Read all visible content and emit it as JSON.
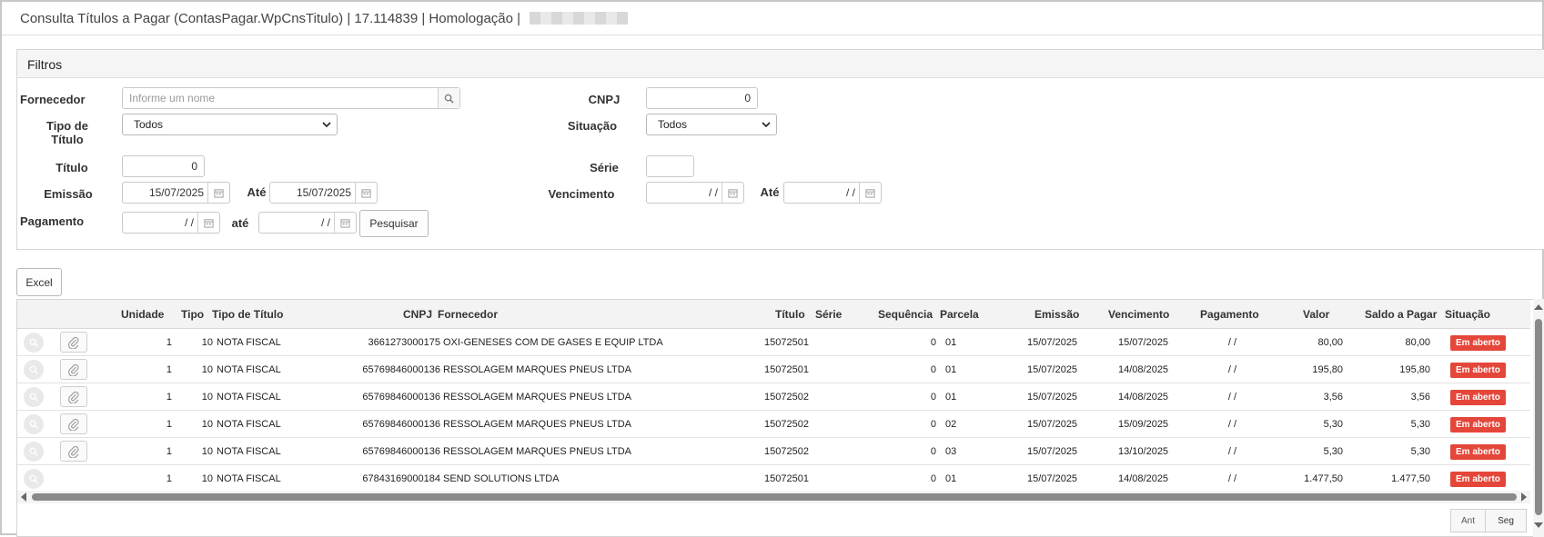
{
  "window": {
    "title": "Consulta Títulos a Pagar (ContasPagar.WpCnsTitulo) | 17.114839 | Homologação |"
  },
  "filters": {
    "header": "Filtros",
    "fornecedor_label": "Fornecedor",
    "fornecedor_placeholder": "Informe um nome",
    "cnpj_label": "CNPJ",
    "cnpj_value": "0",
    "tipo_titulo_label": "Tipo de Título",
    "tipo_titulo_value": "Todos",
    "situacao_label": "Situação",
    "situacao_value": "Todos",
    "titulo_label": "Título",
    "titulo_value": "0",
    "serie_label": "Série",
    "serie_value": "",
    "emissao_label": "Emissão",
    "emissao_de": "15/07/2025",
    "ate_label": "Até",
    "emissao_ate": "15/07/2025",
    "vencimento_label": "Vencimento",
    "vencimento_de": "/ /",
    "vencimento_ate": "/ /",
    "pagamento_label": "Pagamento",
    "pagamento_de": "/ /",
    "ate_lower_label": "até",
    "pagamento_ate": "/ /",
    "pesquisar_label": "Pesquisar"
  },
  "toolbar": {
    "excel_label": "Excel"
  },
  "table": {
    "headers": [
      "Unidade",
      "Tipo",
      "Tipo de Título",
      "CNPJ",
      "Fornecedor",
      "Título",
      "Série",
      "Sequência",
      "Parcela",
      "Emissão",
      "Vencimento",
      "Pagamento",
      "Valor",
      "Saldo a Pagar",
      "Situação"
    ],
    "rows": [
      {
        "unidade": "1",
        "tipo": "10",
        "tipo_titulo": "NOTA FISCAL",
        "cnpj": "3661273000175",
        "fornecedor": "OXI-GENESES COM DE GASES E EQUIP LTDA",
        "titulo": "15072501",
        "serie": "",
        "sequencia": "0",
        "parcela": "01",
        "emissao": "15/07/2025",
        "vencimento": "15/07/2025",
        "pagamento": "/ /",
        "valor": "80,00",
        "saldo": "80,00",
        "situacao": "Em aberto",
        "has_attach": true
      },
      {
        "unidade": "1",
        "tipo": "10",
        "tipo_titulo": "NOTA FISCAL",
        "cnpj": "65769846000136",
        "fornecedor": "RESSOLAGEM MARQUES PNEUS LTDA",
        "titulo": "15072501",
        "serie": "",
        "sequencia": "0",
        "parcela": "01",
        "emissao": "15/07/2025",
        "vencimento": "14/08/2025",
        "pagamento": "/ /",
        "valor": "195,80",
        "saldo": "195,80",
        "situacao": "Em aberto",
        "has_attach": true
      },
      {
        "unidade": "1",
        "tipo": "10",
        "tipo_titulo": "NOTA FISCAL",
        "cnpj": "65769846000136",
        "fornecedor": "RESSOLAGEM MARQUES PNEUS LTDA",
        "titulo": "15072502",
        "serie": "",
        "sequencia": "0",
        "parcela": "01",
        "emissao": "15/07/2025",
        "vencimento": "14/08/2025",
        "pagamento": "/ /",
        "valor": "3,56",
        "saldo": "3,56",
        "situacao": "Em aberto",
        "has_attach": true
      },
      {
        "unidade": "1",
        "tipo": "10",
        "tipo_titulo": "NOTA FISCAL",
        "cnpj": "65769846000136",
        "fornecedor": "RESSOLAGEM MARQUES PNEUS LTDA",
        "titulo": "15072502",
        "serie": "",
        "sequencia": "0",
        "parcela": "02",
        "emissao": "15/07/2025",
        "vencimento": "15/09/2025",
        "pagamento": "/ /",
        "valor": "5,30",
        "saldo": "5,30",
        "situacao": "Em aberto",
        "has_attach": true
      },
      {
        "unidade": "1",
        "tipo": "10",
        "tipo_titulo": "NOTA FISCAL",
        "cnpj": "65769846000136",
        "fornecedor": "RESSOLAGEM MARQUES PNEUS LTDA",
        "titulo": "15072502",
        "serie": "",
        "sequencia": "0",
        "parcela": "03",
        "emissao": "15/07/2025",
        "vencimento": "13/10/2025",
        "pagamento": "/ /",
        "valor": "5,30",
        "saldo": "5,30",
        "situacao": "Em aberto",
        "has_attach": true
      },
      {
        "unidade": "1",
        "tipo": "10",
        "tipo_titulo": "NOTA FISCAL",
        "cnpj": "67843169000184",
        "fornecedor": "SEND SOLUTIONS LTDA",
        "titulo": "15072501",
        "serie": "",
        "sequencia": "0",
        "parcela": "01",
        "emissao": "15/07/2025",
        "vencimento": "14/08/2025",
        "pagamento": "/ /",
        "valor": "1.477,50",
        "saldo": "1.477,50",
        "situacao": "Em aberto",
        "has_attach": false
      }
    ]
  },
  "pager": {
    "prev_label": "Ant",
    "next_label": "Seg"
  },
  "colors": {
    "badge_red": "#e5463a",
    "header_bg": "#f3f3f3"
  }
}
